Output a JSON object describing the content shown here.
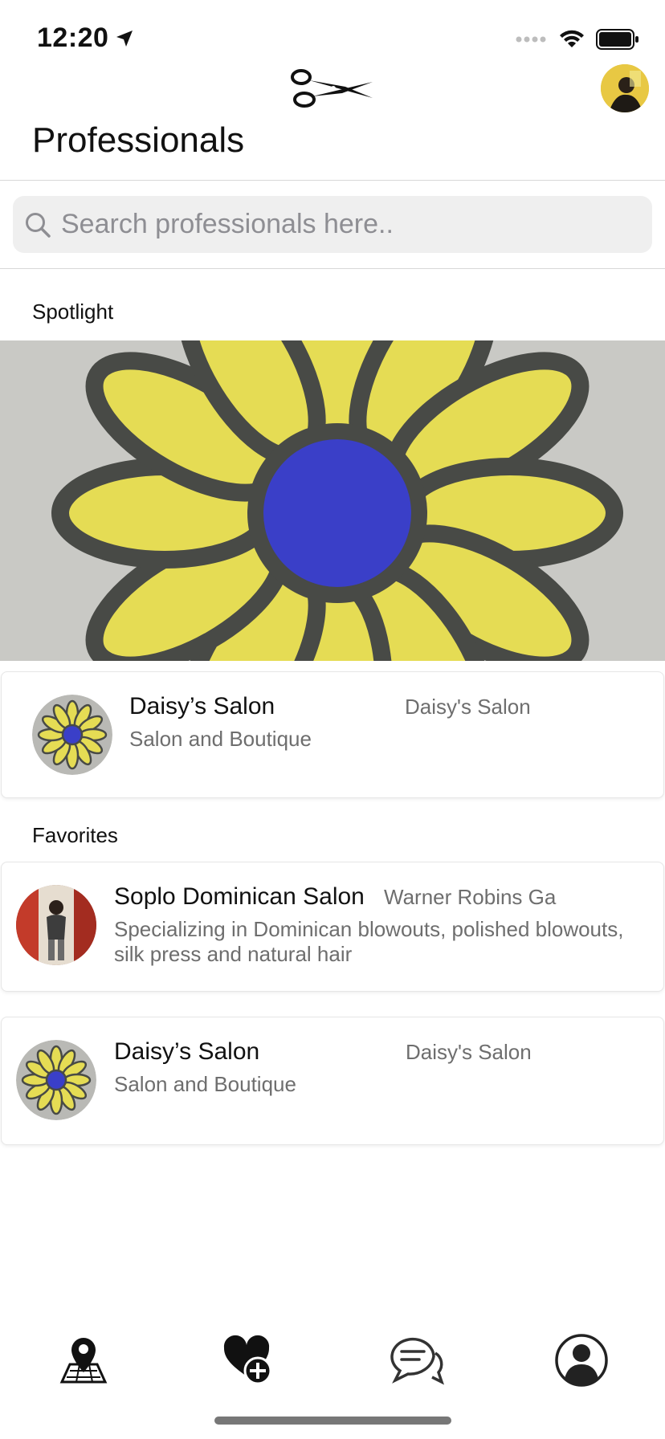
{
  "status_bar": {
    "time": "12:20"
  },
  "header": {
    "title": "Professionals"
  },
  "search": {
    "placeholder": "Search professionals here.."
  },
  "spotlight": {
    "label": "Spotlight",
    "card": {
      "name": "Daisy’s Salon",
      "location": "Daisy's Salon",
      "description": "Salon and Boutique"
    }
  },
  "favorites": {
    "label": "Favorites",
    "items": [
      {
        "name": "Soplo Dominican Salon",
        "location": "Warner Robins Ga",
        "description": "Specializing in Dominican blowouts, polished blowouts, silk press and natural hair"
      },
      {
        "name": "Daisy’s Salon",
        "location": "Daisy's Salon",
        "description": "Salon and Boutique"
      }
    ]
  },
  "tabs": [
    {
      "icon": "map-pin-icon"
    },
    {
      "icon": "heart-plus-icon"
    },
    {
      "icon": "chat-bubbles-icon"
    },
    {
      "icon": "user-profile-icon"
    }
  ],
  "colors": {
    "daisy_petal": "#e5dc54",
    "daisy_center": "#3a3fc8",
    "daisy_outline": "#4a4c48",
    "muted_text": "#6e6e6e"
  }
}
